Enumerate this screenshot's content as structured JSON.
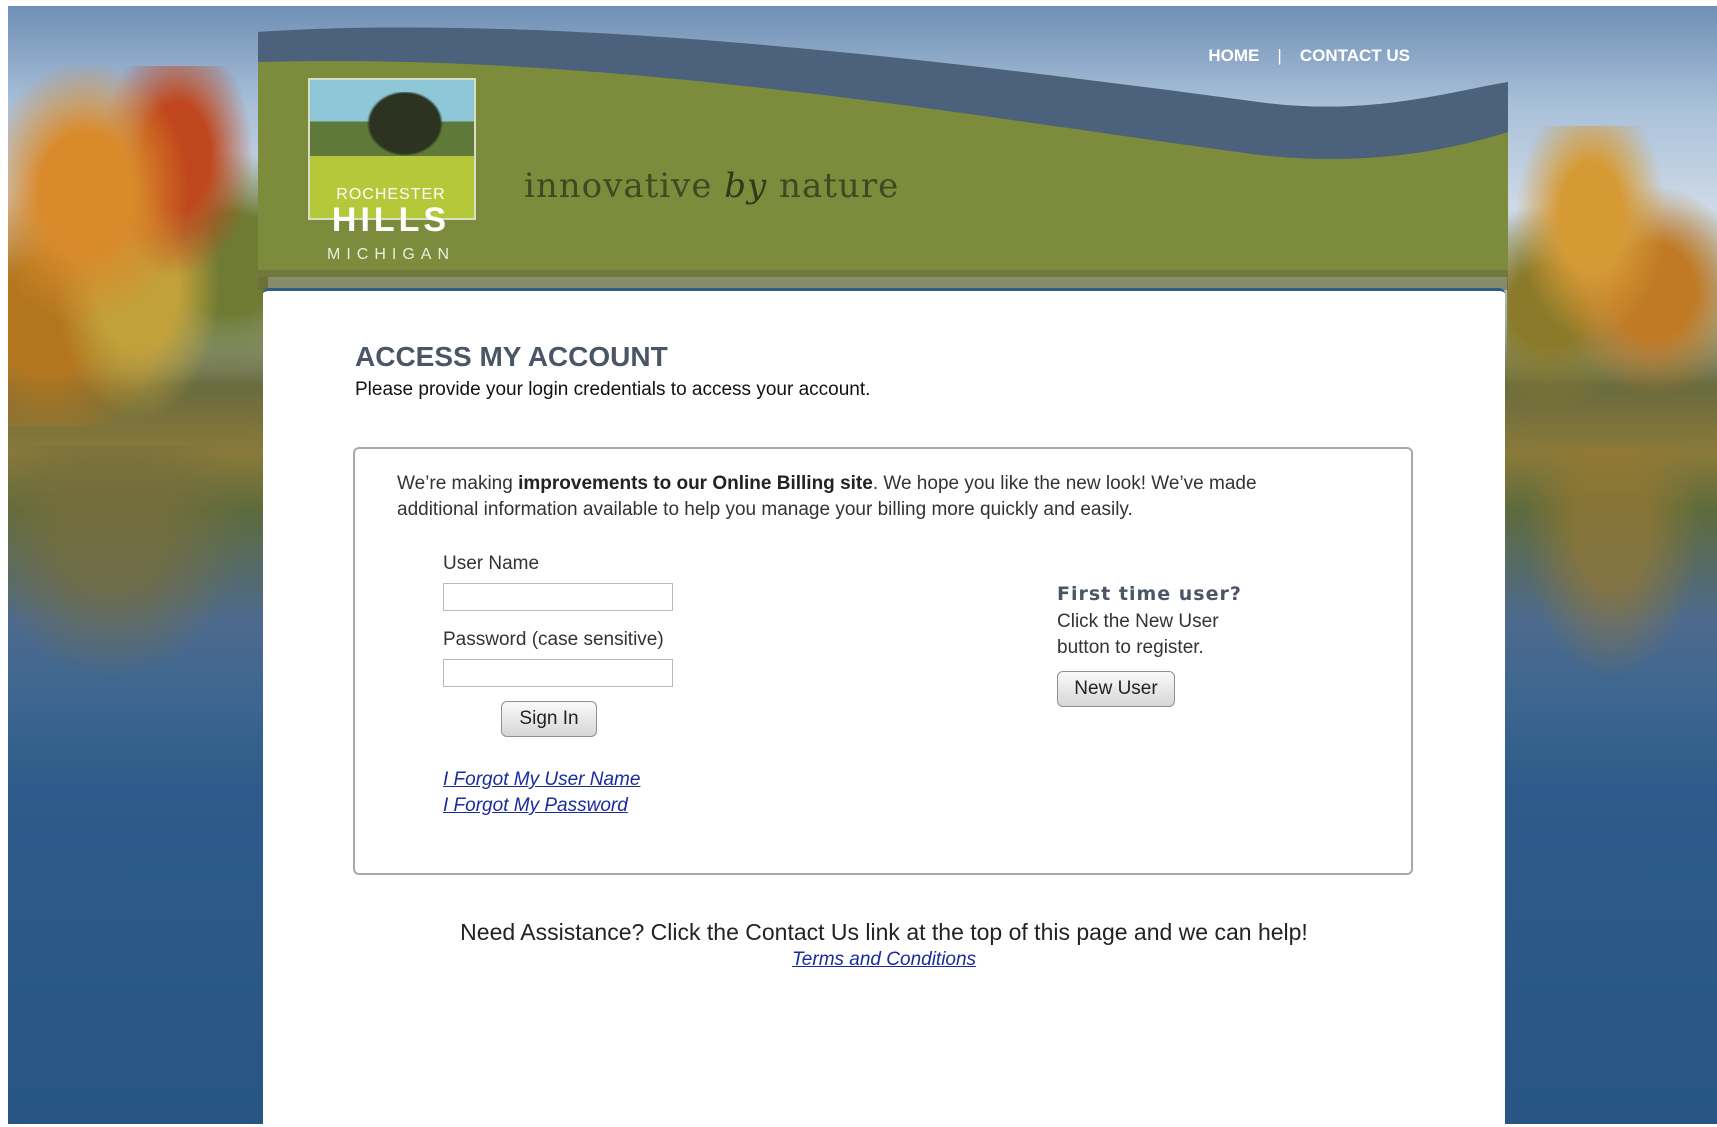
{
  "brand": {
    "logo_line1": "ROCHESTER",
    "logo_line2": "HILLS",
    "logo_line3": "MICHIGAN",
    "tagline_part1": "innovative",
    "tagline_by": "by",
    "tagline_part2": "nature"
  },
  "topnav": {
    "home": "HOME",
    "separator": "|",
    "contact": "CONTACT US"
  },
  "page": {
    "title": "ACCESS MY ACCOUNT",
    "subtitle": "Please provide your login credentials to access your account."
  },
  "notice": {
    "part1": "We’re making ",
    "bold": "improvements to our Online Billing site",
    "part2": ". We hope you like the new look! We’ve made additional information available to help you manage your billing more quickly and easily."
  },
  "login": {
    "username_label": "User Name",
    "username_value": "",
    "password_label": "Password (case sensitive)",
    "password_value": "",
    "sign_in_label": "Sign In",
    "forgot_username": "I Forgot My User Name",
    "forgot_password": "I Forgot My Password"
  },
  "new_user": {
    "title": "First time user?",
    "text": "Click the New User button to register.",
    "button_label": "New User"
  },
  "footer": {
    "help_text": "Need Assistance? Click the Contact Us link at the top of this page and we can help!",
    "terms_link": "Terms and Conditions"
  },
  "colors": {
    "banner_green": "#7d8b3d",
    "banner_blue_swoosh": "#4b617c",
    "title_color": "#4a5666",
    "link_color": "#1a2b9e"
  }
}
